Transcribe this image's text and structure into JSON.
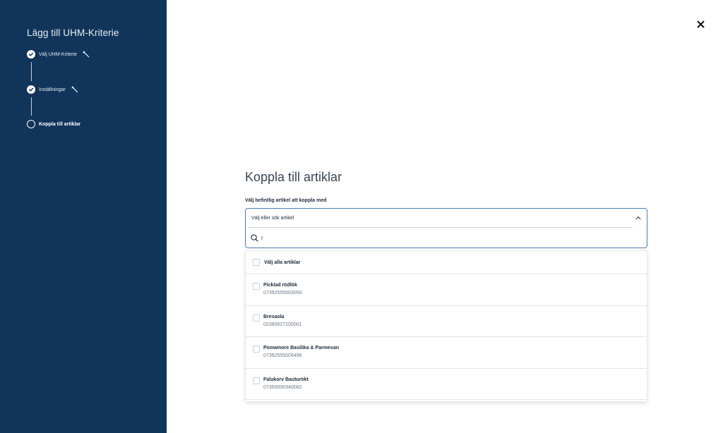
{
  "sidebar": {
    "title": "Lägg till UHM-Kriterie",
    "steps": [
      {
        "label": "Välj UHM-Kriterie",
        "status": "done",
        "icon": "check-circle-icon"
      },
      {
        "label": "Inställningar",
        "status": "done",
        "icon": "check-circle-icon"
      },
      {
        "label": "Koppla till artiklar",
        "status": "active",
        "icon": "empty-circle-icon"
      }
    ],
    "edit_icon": "pencil-icon"
  },
  "close": {
    "icon": "close-icon"
  },
  "main": {
    "heading": "Koppla till artiklar",
    "field_label": "Välj befintlig artikel att koppla med",
    "select": {
      "value": "Välj eller sök artikel",
      "search_value": "r"
    },
    "options": {
      "select_all": "Välj alla artiklar",
      "items": [
        {
          "name": "Picklad rödlök",
          "code": "07392555003050"
        },
        {
          "name": "Bresaola",
          "code": "02385627200001"
        },
        {
          "name": "Pomamore Basilika & Parmesan",
          "code": "07392555009496"
        },
        {
          "name": "Falukorv Basturökt",
          "code": "07350000340082"
        }
      ]
    }
  },
  "colors": {
    "sidebar_bg": "#11345a",
    "accent_border": "#4b7bb0"
  }
}
